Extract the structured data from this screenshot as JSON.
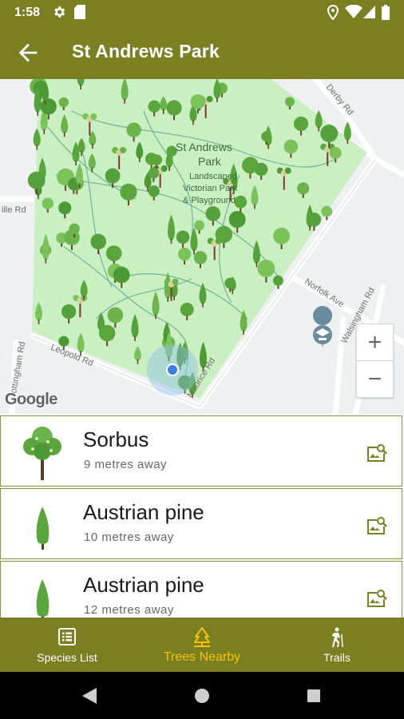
{
  "status_bar": {
    "time": "1:58"
  },
  "app_bar": {
    "title": "St Andrews Park",
    "back_icon": "arrow-back-icon"
  },
  "map": {
    "park_name": "St Andrews Park",
    "park_label_line1": "St Andrews",
    "park_label_line2": "Park",
    "sub_label_line1": "Landscaped",
    "sub_label_line2": "Victorian Park",
    "sub_label_line3": "& Playground",
    "roads": {
      "derby": "Derby Rd",
      "ville": "ille Rd",
      "leopold": "Leopold Rd",
      "maurice": "Maurice Rd",
      "norfolk": "Norfolk Ave",
      "walsingham": "Walsingham Rd",
      "ottingham": "ottingham Rd"
    },
    "zoom_in": "+",
    "zoom_out": "−",
    "attribution": "Google"
  },
  "trees": [
    {
      "name": "Sorbus",
      "distance": "9 metres away",
      "icon": "round-tree-icon"
    },
    {
      "name": "Austrian pine",
      "distance": "10 metres away",
      "icon": "conifer-tree-icon"
    },
    {
      "name": "Austrian pine",
      "distance": "12 metres away",
      "icon": "conifer-tree-icon"
    }
  ],
  "bottom_nav": [
    {
      "label": "Species List",
      "icon": "list-icon",
      "active": false
    },
    {
      "label": "Trees Nearby",
      "icon": "tree-nearby-icon",
      "active": true
    },
    {
      "label": "Trails",
      "icon": "hiker-icon",
      "active": false
    }
  ],
  "colors": {
    "primary": "#7a7f22",
    "accent": "#f6c400",
    "park": "#c9efc3"
  }
}
